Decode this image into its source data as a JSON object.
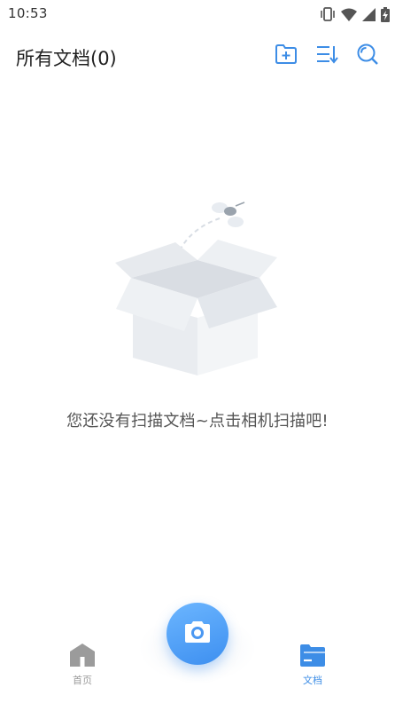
{
  "status_bar": {
    "time": "10:53",
    "icons": [
      "vibrate-icon",
      "wifi-icon",
      "signal-icon",
      "battery-charging-icon"
    ]
  },
  "header": {
    "title": "所有文档(0)",
    "actions": [
      "new-folder-icon",
      "sort-icon",
      "search-icon"
    ],
    "accent_color": "#3d8de6"
  },
  "empty_state": {
    "message": "您还没有扫描文档~点击相机扫描吧!",
    "illustration": "empty-box-icon"
  },
  "bottom_nav": {
    "home_label": "首页",
    "docs_label": "文档",
    "active_tab": "文档",
    "active_color": "#3d8de6",
    "inactive_color": "#9b9b9b",
    "camera_icon": "camera-icon"
  }
}
